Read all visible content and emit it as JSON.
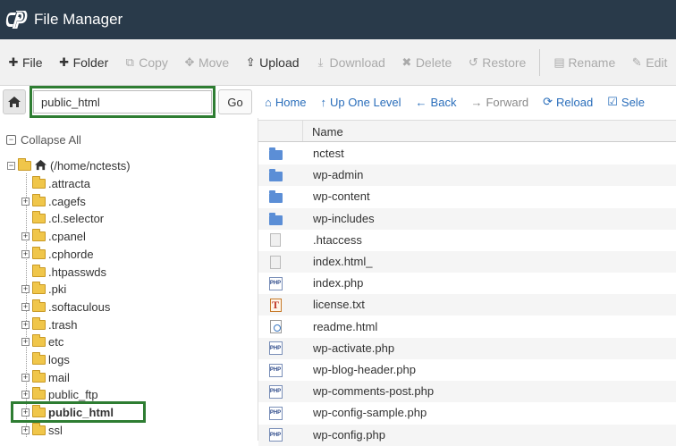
{
  "app": {
    "title": "File Manager"
  },
  "toolbar": [
    {
      "label": "File",
      "icon": "plus-icon",
      "glyph": "✚",
      "enabled": true
    },
    {
      "label": "Folder",
      "icon": "plus-icon",
      "glyph": "✚",
      "enabled": true
    },
    {
      "label": "Copy",
      "icon": "copy-icon",
      "glyph": "⧉",
      "enabled": false
    },
    {
      "label": "Move",
      "icon": "move-icon",
      "glyph": "✥",
      "enabled": false
    },
    {
      "label": "Upload",
      "icon": "upload-icon",
      "glyph": "⇪",
      "enabled": true
    },
    {
      "label": "Download",
      "icon": "download-icon",
      "glyph": "⤓",
      "enabled": false
    },
    {
      "label": "Delete",
      "icon": "delete-icon",
      "glyph": "✖",
      "enabled": false
    },
    {
      "label": "Restore",
      "icon": "restore-icon",
      "glyph": "↺",
      "enabled": false
    },
    {
      "label": "Rename",
      "icon": "rename-icon",
      "glyph": "▤",
      "enabled": false
    },
    {
      "label": "Edit",
      "icon": "edit-icon",
      "glyph": "✎",
      "enabled": false
    }
  ],
  "pathbar": {
    "value": "public_html",
    "go_label": "Go"
  },
  "navbar": [
    {
      "label": "Home",
      "icon": "home-icon",
      "glyph": "⌂",
      "enabled": true
    },
    {
      "label": "Up One Level",
      "icon": "arrow-up-icon",
      "glyph": "↑",
      "enabled": true
    },
    {
      "label": "Back",
      "icon": "arrow-left-icon",
      "glyph": "←",
      "enabled": true
    },
    {
      "label": "Forward",
      "icon": "arrow-right-icon",
      "glyph": "→",
      "enabled": false
    },
    {
      "label": "Reload",
      "icon": "reload-icon",
      "glyph": "⟳",
      "enabled": true
    },
    {
      "label": "Sele",
      "icon": "select-icon",
      "glyph": "☑",
      "enabled": true
    }
  ],
  "tree": {
    "collapse_label": "Collapse All",
    "root_label": "(/home/nctests)",
    "items": [
      {
        "label": ".attracta",
        "expandable": false,
        "selected": false
      },
      {
        "label": ".cagefs",
        "expandable": true,
        "selected": false
      },
      {
        "label": ".cl.selector",
        "expandable": false,
        "selected": false
      },
      {
        "label": ".cpanel",
        "expandable": true,
        "selected": false
      },
      {
        "label": ".cphorde",
        "expandable": true,
        "selected": false
      },
      {
        "label": ".htpasswds",
        "expandable": false,
        "selected": false
      },
      {
        "label": ".pki",
        "expandable": true,
        "selected": false
      },
      {
        "label": ".softaculous",
        "expandable": true,
        "selected": false
      },
      {
        "label": ".trash",
        "expandable": true,
        "selected": false
      },
      {
        "label": "etc",
        "expandable": true,
        "selected": false
      },
      {
        "label": "logs",
        "expandable": false,
        "selected": false
      },
      {
        "label": "mail",
        "expandable": true,
        "selected": false
      },
      {
        "label": "public_ftp",
        "expandable": true,
        "selected": false
      },
      {
        "label": "public_html",
        "expandable": true,
        "selected": true
      },
      {
        "label": "ssl",
        "expandable": true,
        "selected": false
      }
    ]
  },
  "filelist": {
    "header_name": "Name",
    "files": [
      {
        "name": "nctest",
        "type": "folder"
      },
      {
        "name": "wp-admin",
        "type": "folder"
      },
      {
        "name": "wp-content",
        "type": "folder"
      },
      {
        "name": "wp-includes",
        "type": "folder"
      },
      {
        "name": ".htaccess",
        "type": "doc"
      },
      {
        "name": "index.html_",
        "type": "doc"
      },
      {
        "name": "index.php",
        "type": "php"
      },
      {
        "name": "license.txt",
        "type": "txt"
      },
      {
        "name": "readme.html",
        "type": "html"
      },
      {
        "name": "wp-activate.php",
        "type": "php"
      },
      {
        "name": "wp-blog-header.php",
        "type": "php"
      },
      {
        "name": "wp-comments-post.php",
        "type": "php"
      },
      {
        "name": "wp-config-sample.php",
        "type": "php"
      },
      {
        "name": "wp-config.php",
        "type": "php"
      }
    ]
  },
  "colors": {
    "titlebar": "#293a4a",
    "highlight": "#2e7d32",
    "link": "#2a6ebb",
    "folder_tree": "#f0c64a",
    "folder_list": "#5b8ed6"
  }
}
